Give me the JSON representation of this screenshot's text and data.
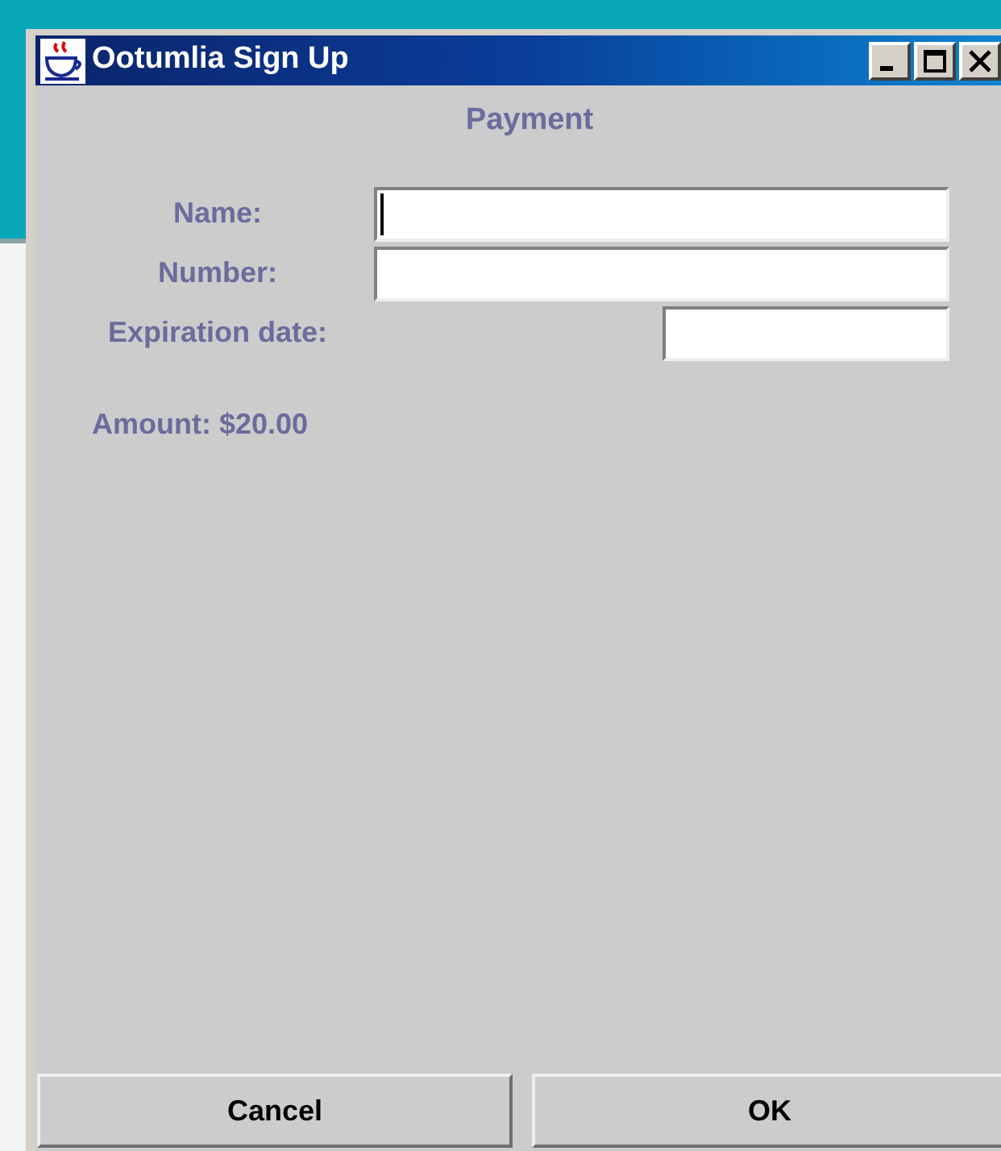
{
  "window": {
    "title": "Ootumlia Sign Up"
  },
  "heading": "Payment",
  "fields": [
    {
      "label": "Name:",
      "kind": "wide",
      "focused": true
    },
    {
      "label": "Number:",
      "kind": "wide",
      "focused": false
    },
    {
      "label": "Expiration date:",
      "kind": "short",
      "focused": false
    }
  ],
  "amount": "Amount: $20.00",
  "buttons": [
    "Cancel",
    "OK"
  ]
}
